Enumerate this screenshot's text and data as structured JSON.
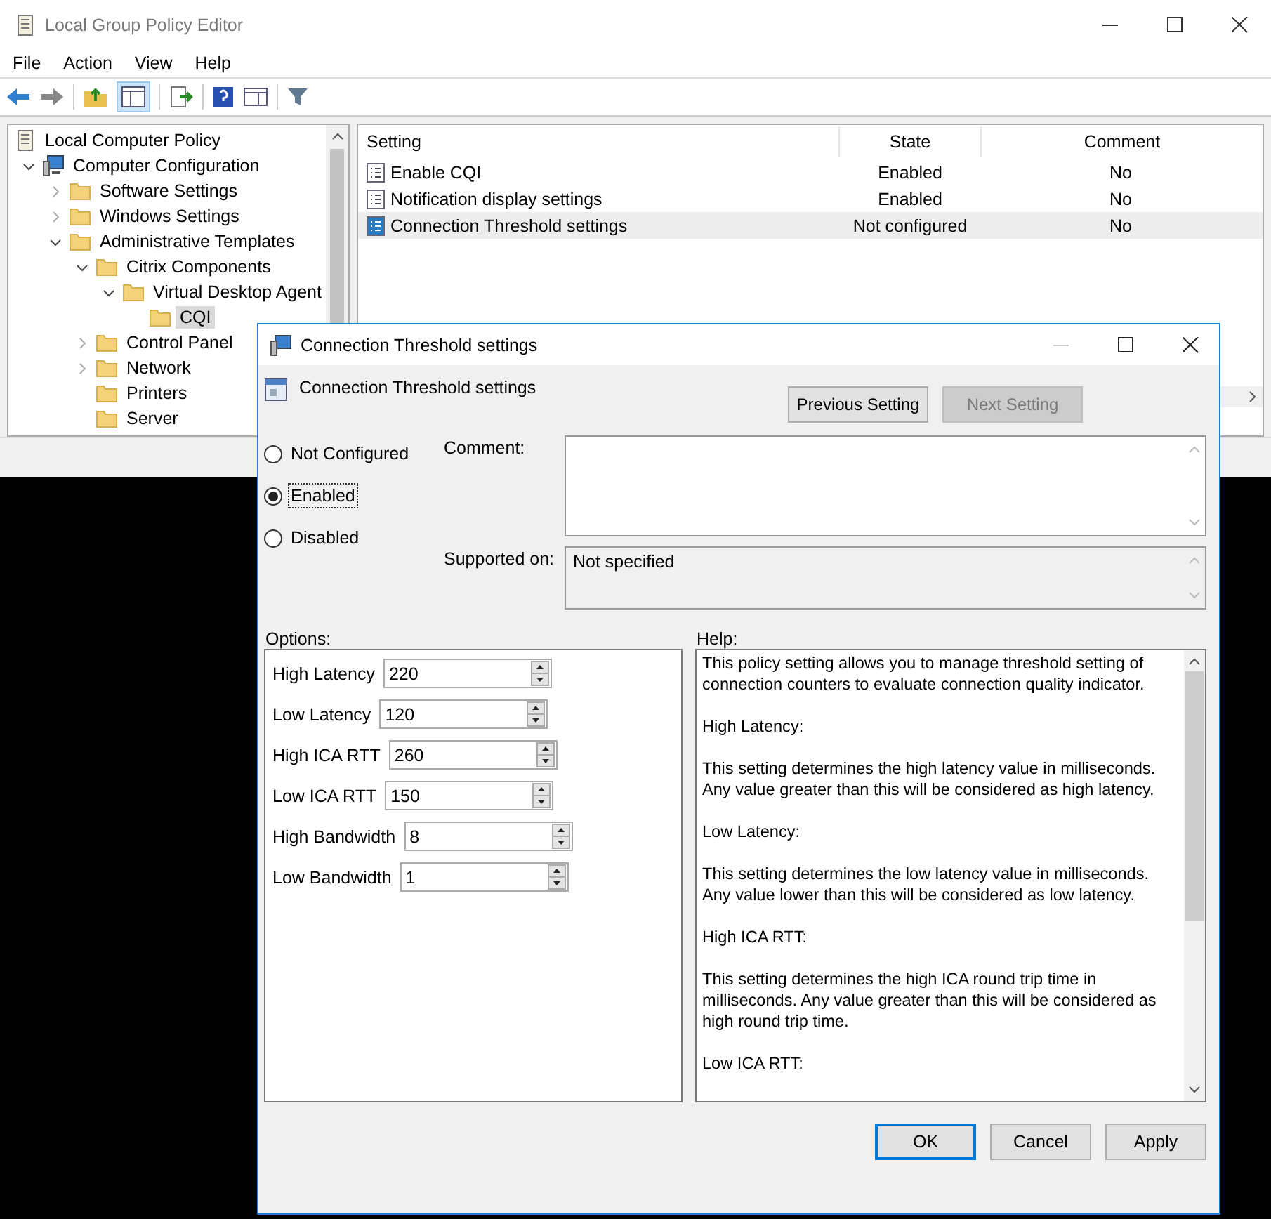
{
  "window": {
    "title": "Local Group Policy Editor"
  },
  "menu": [
    "File",
    "Action",
    "View",
    "Help"
  ],
  "tree": [
    {
      "label": "Local Computer Policy",
      "kind": "policy",
      "selected": false,
      "children": [
        {
          "label": "Computer Configuration",
          "kind": "computer",
          "expanded": true,
          "selected": false,
          "children": [
            {
              "label": "Software Settings",
              "kind": "folder",
              "expanded": false,
              "selected": false
            },
            {
              "label": "Windows Settings",
              "kind": "folder",
              "expanded": false,
              "selected": false
            },
            {
              "label": "Administrative Templates",
              "kind": "folder",
              "expanded": true,
              "selected": false,
              "children": [
                {
                  "label": "Citrix Components",
                  "kind": "folder",
                  "expanded": true,
                  "selected": false,
                  "children": [
                    {
                      "label": "Virtual Desktop Agent",
                      "kind": "folder",
                      "expanded": true,
                      "selected": false,
                      "children": [
                        {
                          "label": "CQI",
                          "kind": "folder",
                          "selected": true
                        }
                      ]
                    }
                  ]
                },
                {
                  "label": "Control Panel",
                  "kind": "folder",
                  "expanded": false,
                  "selected": false
                },
                {
                  "label": "Network",
                  "kind": "folder",
                  "expanded": false,
                  "selected": false
                },
                {
                  "label": "Printers",
                  "kind": "folder",
                  "selected": false
                },
                {
                  "label": "Server",
                  "kind": "folder",
                  "selected": false
                }
              ]
            }
          ]
        }
      ]
    }
  ],
  "list": {
    "columns": [
      "Setting",
      "State",
      "Comment"
    ],
    "rows": [
      {
        "setting": "Enable CQI",
        "state": "Enabled",
        "comment": "No",
        "selected": false
      },
      {
        "setting": "Notification display settings",
        "state": "Enabled",
        "comment": "No",
        "selected": false
      },
      {
        "setting": "Connection Threshold settings",
        "state": "Not configured",
        "comment": "No",
        "selected": true
      }
    ]
  },
  "dialog": {
    "title": "Connection Threshold settings",
    "heading": "Connection Threshold settings",
    "nav_buttons": [
      {
        "label": "Previous Setting",
        "disabled": false
      },
      {
        "label": "Next Setting",
        "disabled": true
      }
    ],
    "radios": [
      {
        "label": "Not Configured",
        "selected": false
      },
      {
        "label": "Enabled",
        "selected": true
      },
      {
        "label": "Disabled",
        "selected": false
      }
    ],
    "comment_label": "Comment:",
    "supported_label": "Supported on:",
    "supported_value": "Not specified",
    "options_label": "Options:",
    "help_label": "Help:",
    "options": [
      {
        "label": "High Latency",
        "value": "220"
      },
      {
        "label": "Low Latency",
        "value": "120"
      },
      {
        "label": "High ICA RTT",
        "value": "260"
      },
      {
        "label": "Low ICA RTT",
        "value": "150"
      },
      {
        "label": "High Bandwidth",
        "value": "8"
      },
      {
        "label": "Low Bandwidth",
        "value": "1"
      }
    ],
    "help": [
      "This policy setting allows you to manage threshold setting of connection counters to evaluate connection quality indicator.",
      "High Latency:",
      "This setting determines the high latency value in milliseconds. Any value greater than this will be considered as high latency.",
      "Low Latency:",
      "This setting determines the low latency value in milliseconds. Any value lower than this will be considered as low latency.",
      "High ICA RTT:",
      "This setting determines the high ICA round trip time in milliseconds. Any value greater than this will be considered as high round trip time.",
      "Low ICA RTT:"
    ],
    "buttons": [
      {
        "label": "OK",
        "default": true
      },
      {
        "label": "Cancel",
        "default": false
      },
      {
        "label": "Apply",
        "default": false
      }
    ]
  }
}
